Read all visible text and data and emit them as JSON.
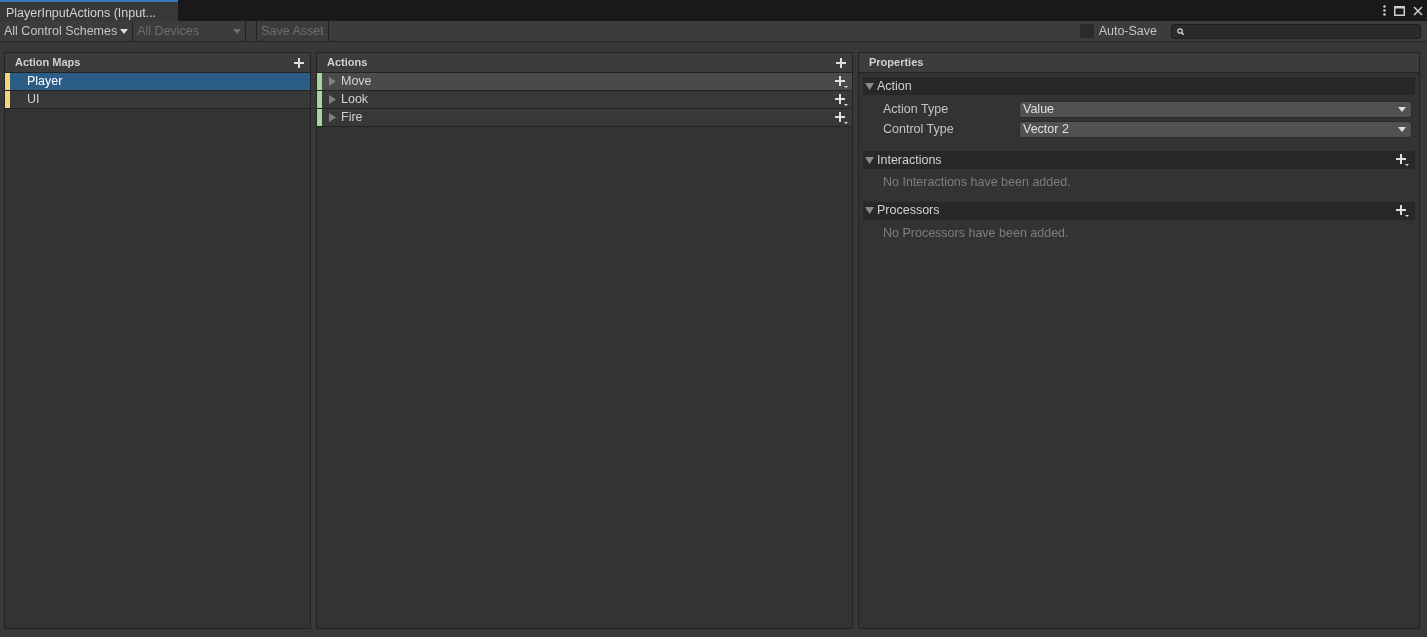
{
  "window": {
    "title": "PlayerInputActions (Input..."
  },
  "toolbar": {
    "control_scheme": "All Control Schemes",
    "devices": {
      "label": "All Devices",
      "disabled": true
    },
    "save_button": {
      "label": "Save Asset",
      "disabled": true
    },
    "auto_save": {
      "label": "Auto-Save",
      "checked": false
    }
  },
  "action_maps": {
    "title": "Action Maps",
    "items": [
      {
        "label": "Player",
        "selected": true,
        "color": "#f5d77a"
      },
      {
        "label": "UI",
        "selected": false,
        "color": "#f5d77a"
      }
    ]
  },
  "actions": {
    "title": "Actions",
    "items": [
      {
        "label": "Move",
        "selected": true,
        "expanded": false,
        "color": "#a6d69a"
      },
      {
        "label": "Look",
        "selected": false,
        "expanded": false,
        "color": "#a6d69a"
      },
      {
        "label": "Fire",
        "selected": false,
        "expanded": false,
        "color": "#a6d69a"
      }
    ]
  },
  "properties": {
    "title": "Properties",
    "sections": [
      {
        "kind": "fields",
        "title": "Action",
        "expanded": true,
        "fields": [
          {
            "label": "Action Type",
            "value": "Value"
          },
          {
            "label": "Control Type",
            "value": "Vector 2"
          }
        ]
      },
      {
        "kind": "list",
        "title": "Interactions",
        "expanded": true,
        "empty_text": "No Interactions have been added."
      },
      {
        "kind": "list",
        "title": "Processors",
        "expanded": true,
        "empty_text": "No Processors have been added."
      }
    ]
  }
}
